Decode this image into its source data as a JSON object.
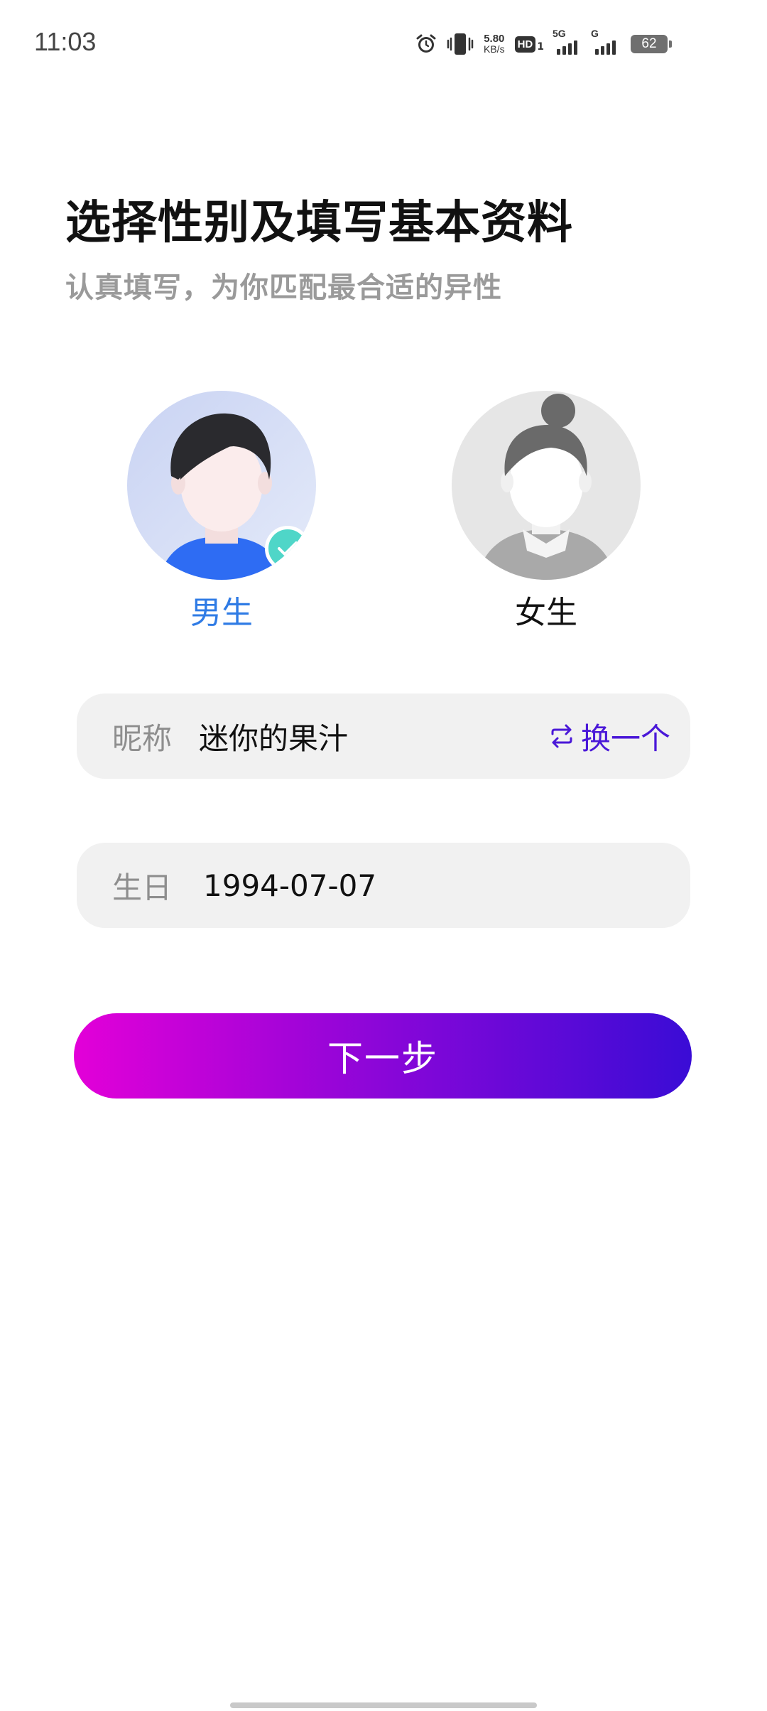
{
  "status_bar": {
    "time": "11:03",
    "net_speed_value": "5.80",
    "net_speed_unit": "KB/s",
    "hd_badge": "HD",
    "hd_sub": "1",
    "signal_1_label": "5G",
    "signal_2_label": "G",
    "battery": "62",
    "icons": [
      "alarm-icon",
      "vibrate-icon"
    ]
  },
  "header": {
    "title": "选择性别及填写基本资料",
    "subtitle": "认真填写，为你匹配最合适的异性"
  },
  "gender": {
    "options": [
      {
        "label": "男生",
        "selected": true,
        "color": "#2f7be5"
      },
      {
        "label": "女生",
        "selected": false,
        "color": "#111111"
      }
    ],
    "check_color": "#4fd6c8"
  },
  "form": {
    "nickname": {
      "label": "昵称",
      "value": "迷你的果汁",
      "swap_label": "换一个"
    },
    "birthday": {
      "label": "生日",
      "value": "1994-07-07"
    }
  },
  "next_button": {
    "label": "下一步",
    "gradient": [
      "#e300d8",
      "#8a06d8",
      "#3a0cd6"
    ]
  }
}
